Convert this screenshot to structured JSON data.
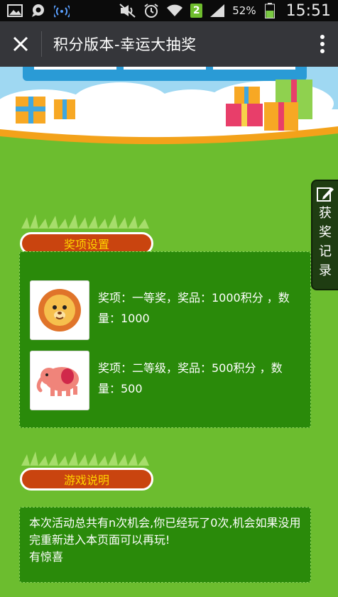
{
  "status_bar": {
    "battery_percent": "52%",
    "sim_slot": "2",
    "time": "15:51"
  },
  "title_bar": {
    "title": "积分版本-幸运大抽奖"
  },
  "side_tab": {
    "label": "获奖记录"
  },
  "prize_section": {
    "header": "奖项设置",
    "items": [
      {
        "text": "奖项：一等奖，奖品：1000积分 ，数量：1000",
        "icon": "lion-icon"
      },
      {
        "text": "奖项：二等级，奖品：500积分 ，数量：500",
        "icon": "elephant-icon"
      }
    ]
  },
  "game_section": {
    "header": "游戏说明",
    "line1": "本次活动总共有n次机会,你已经玩了0次,机会如果没用完重新进入本页面可以再玩!",
    "line2": "有惊喜"
  }
}
